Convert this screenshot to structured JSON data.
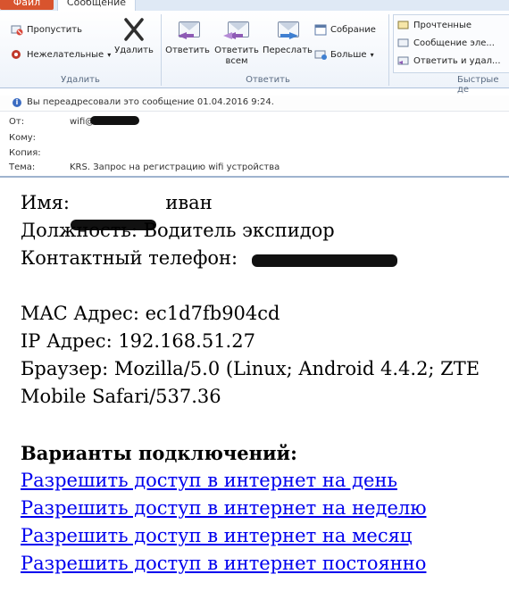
{
  "ribbon": {
    "tab_file": "Файл",
    "tab_message": "Сообщение",
    "groups": {
      "delete_label": "Удалить",
      "reply_label": "Ответить",
      "quick_label": "Быстрые де"
    },
    "ignore": "Пропустить",
    "junk": "Нежелательные",
    "delete": "Удалить",
    "reply": "Ответить",
    "reply_all_1": "Ответить",
    "reply_all_2": "всем",
    "forward": "Переслать",
    "meeting": "Собрание",
    "more": "Больше",
    "quick": {
      "item1": "Прочтенные",
      "item2": "Сообщение эле...",
      "item3": "Ответить и удал..."
    }
  },
  "header": {
    "info": "Вы переадресовали это сообщение 01.04.2016 9:24.",
    "from_label": "От:",
    "from_value": "wifi@",
    "to_label": "Кому:",
    "cc_label": "Копия:",
    "subject_label": "Тема:",
    "subject_value": "KRS. Запрос на регистрацию wifi устройства"
  },
  "body": {
    "name_prefix": "Имя:",
    "name_suffix": "иван",
    "position": "Должность: Водитель экспидор",
    "phone_prefix": "Контактный телефон:",
    "mac": "MAC Адрес: ec1d7fb904cd",
    "ip": "IP Адрес: 192.168.51.27",
    "browser": "Браузер: Mozilla/5.0 (Linux; Android 4.4.2; ZTE",
    "browser2": "Mobile Safari/537.36",
    "options_title": "Варианты подключений:",
    "links": [
      "Разрешить доступ в интернет на день",
      "Разрешить доступ в интернет на неделю",
      "Разрешить доступ в интернет на месяц",
      "Разрешить доступ в интернет постоянно"
    ]
  },
  "colors": {
    "link": "#0000ee",
    "file_tab": "#d8542e"
  }
}
